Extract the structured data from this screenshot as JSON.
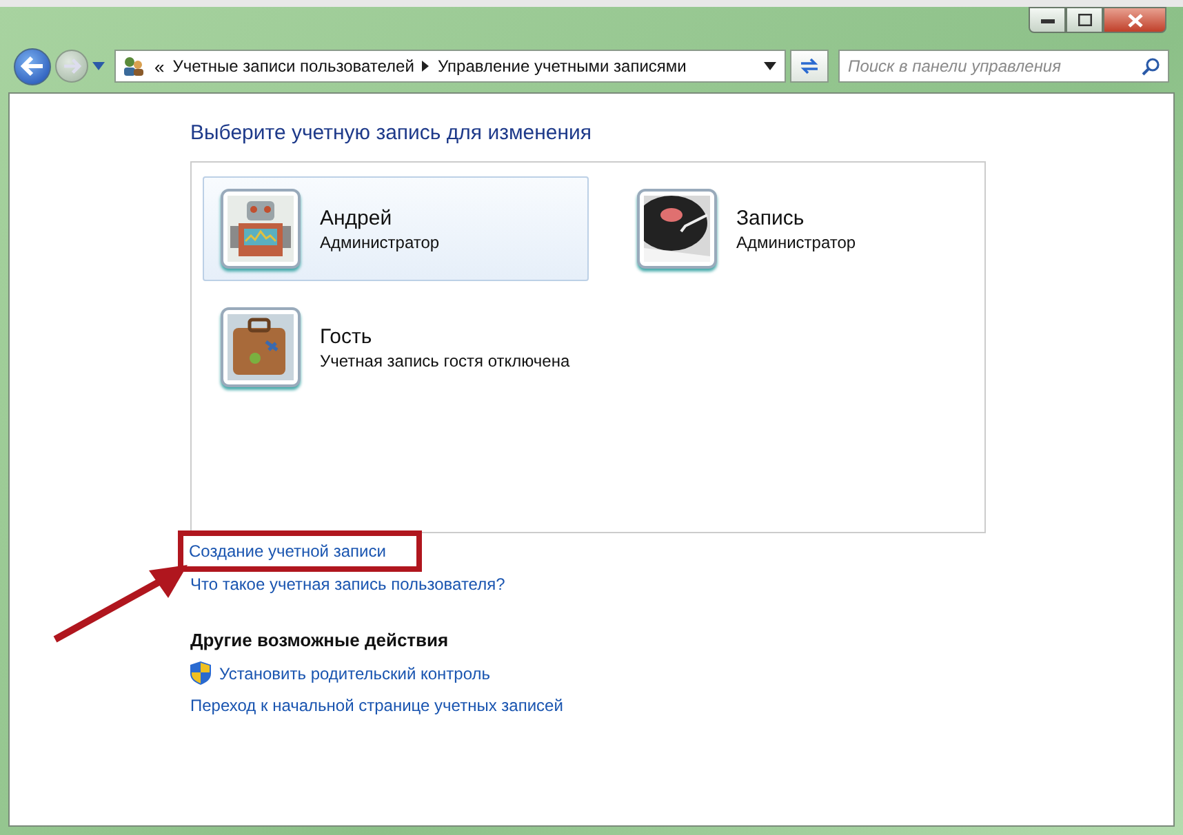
{
  "address_bar": {
    "separator": "«",
    "crumbs": [
      "Учетные записи пользователей",
      "Управление учетными записями"
    ]
  },
  "search": {
    "placeholder": "Поиск в панели управления"
  },
  "heading": "Выберите учетную запись для изменения",
  "accounts": [
    {
      "name": "Андрей",
      "role": "Администратор",
      "kind": "robot",
      "selected": true
    },
    {
      "name": "Запись",
      "role": "Администратор",
      "kind": "record",
      "selected": false
    },
    {
      "name": "Гость",
      "role": "Учетная запись гостя отключена",
      "kind": "suitcase",
      "selected": false
    }
  ],
  "links": [
    {
      "label": "Создание учетной записи",
      "highlighted": true
    },
    {
      "label": "Что такое учетная запись пользователя?",
      "highlighted": false
    }
  ],
  "other_actions": {
    "title": "Другие возможные действия",
    "items": [
      {
        "label": "Установить родительский контроль",
        "kind": "shield"
      },
      {
        "label": "Переход к начальной странице учетных записей",
        "kind": "plain"
      }
    ]
  }
}
